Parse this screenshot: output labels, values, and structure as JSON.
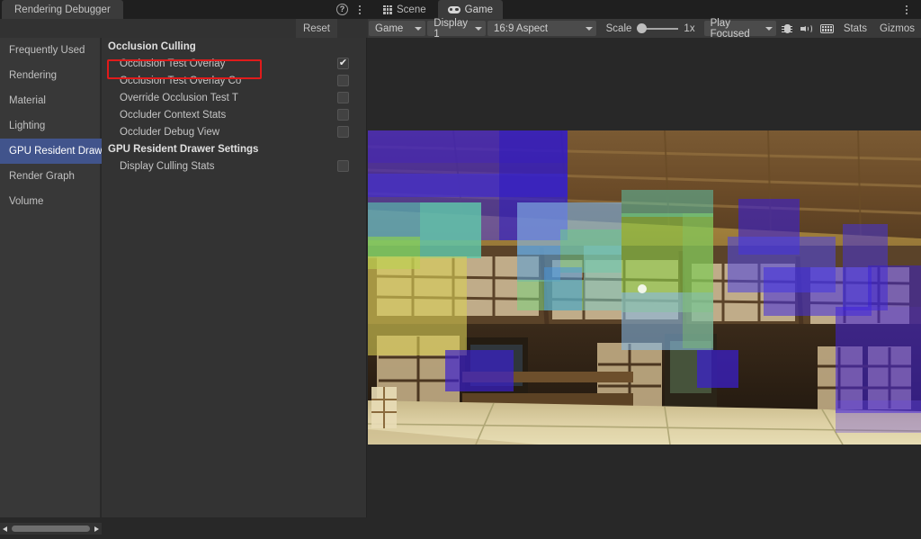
{
  "window": {
    "tab_label": "Rendering Debugger",
    "help_icon": "help-icon",
    "kebab_icon": "kebab-menu-icon",
    "reset_label": "Reset"
  },
  "editor_tabs": [
    {
      "label": "Scene",
      "icon": "grid-icon",
      "active": false
    },
    {
      "label": "Game",
      "icon": "gamepad-icon",
      "active": true
    }
  ],
  "game_toolbar": {
    "target_display_mode": "Game",
    "display": "Display 1",
    "aspect": "16:9 Aspect",
    "scale_label": "Scale",
    "scale_value": "1x",
    "play_mode": "Play Focused",
    "mute_icon": "speaker-icon",
    "bug_icon": "bug-icon",
    "stats_label": "Stats",
    "gizmos_label": "Gizmos",
    "keyboard_icon": "keyboard-icon"
  },
  "sidebar": {
    "items": [
      {
        "label": "Frequently Used",
        "selected": false
      },
      {
        "label": "Rendering",
        "selected": false
      },
      {
        "label": "Material",
        "selected": false
      },
      {
        "label": "Lighting",
        "selected": false
      },
      {
        "label": "GPU Resident Drawer",
        "selected": true
      },
      {
        "label": "Render Graph",
        "selected": false
      },
      {
        "label": "Volume",
        "selected": false
      }
    ]
  },
  "panel": {
    "groups": [
      {
        "title": "Occlusion Culling",
        "rows": [
          {
            "label": "Occlusion Test Overlay",
            "checked": true,
            "highlighted": true
          },
          {
            "label": "Occlusion Test Overlay Co",
            "checked": false,
            "highlighted": false
          },
          {
            "label": "Override Occlusion Test T",
            "checked": false,
            "highlighted": false
          },
          {
            "label": "Occluder Context Stats",
            "checked": false,
            "highlighted": false
          },
          {
            "label": "Occluder Debug View",
            "checked": false,
            "highlighted": false
          }
        ]
      },
      {
        "title": "GPU Resident Drawer Settings",
        "rows": [
          {
            "label": "Display Culling Stats",
            "checked": false,
            "highlighted": false
          }
        ]
      }
    ]
  },
  "colors": {
    "highlight_border": "#e11b1b",
    "selection_blue": "#41548c",
    "panel_bg": "#333333",
    "nav_bg": "#383838",
    "toolbar_bg": "#393939",
    "viewport_bg": "#282828"
  },
  "viewport": {
    "scene_description": "Japanese interior room with wooden ceiling beams, shoji screens and tatami floor, overlaid with semi-transparent occlusion-test color rectangles",
    "overlay_colors": [
      "#3a1fd0",
      "#5bc9b0",
      "#8ed34a",
      "#d8cf55",
      "#86b8e6",
      "#4f46e0"
    ]
  }
}
